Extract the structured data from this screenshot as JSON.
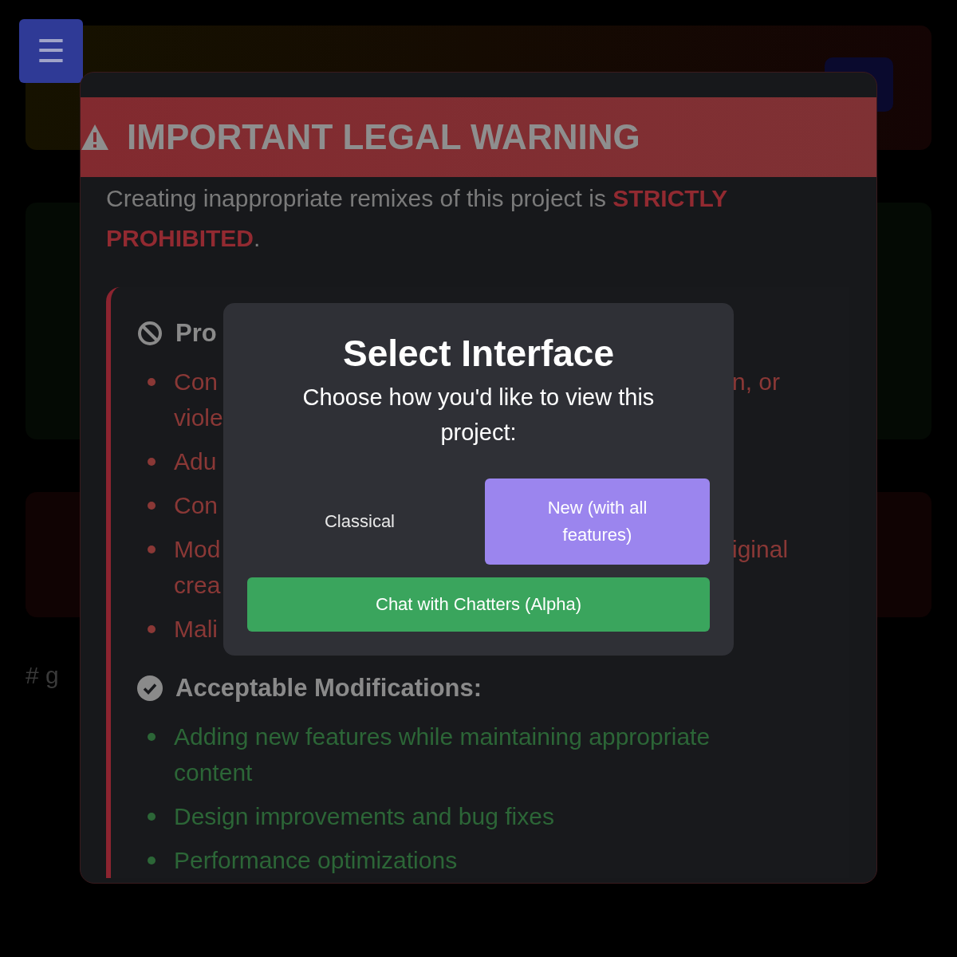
{
  "background": {
    "menu_button": "☰",
    "footer_text": "# g"
  },
  "legal_warning": {
    "title": "IMPORTANT LEGAL WARNING",
    "intro": "Creating inappropriate remixes of this project is **STRICTLY PROHIBITED**.",
    "sections": [
      {
        "kind": "prohibited",
        "heading": "Pro",
        "items": [
          {
            "lines": [
              {
                "start": "Con",
                "end": "n, or"
              },
              {
                "start": "viole"
              }
            ]
          },
          {
            "lines": [
              {
                "start": "Adu"
              }
            ]
          },
          {
            "lines": [
              {
                "start": "Con"
              }
            ]
          },
          {
            "lines": [
              {
                "start": "Mod",
                "end": "iginal"
              },
              {
                "start": "crea"
              }
            ]
          },
          {
            "lines": [
              {
                "start": "Mali"
              }
            ]
          }
        ]
      },
      {
        "kind": "acceptable",
        "heading": "Acceptable Modifications:",
        "items": [
          {
            "lines": [
              {
                "start": "Adding new features while maintaining appropriate"
              },
              {
                "start": "content"
              }
            ]
          },
          {
            "lines": [
              {
                "start": "Design improvements and bug fixes"
              }
            ]
          },
          {
            "lines": [
              {
                "start": "Performance optimizations"
              }
            ]
          }
        ]
      }
    ]
  },
  "dialog": {
    "title": "Select Interface",
    "subtitle": "Choose how you'd like to view this project:",
    "options": [
      {
        "label": "Classical",
        "selected": false
      },
      {
        "label": "New (with all features)",
        "selected": true
      }
    ],
    "chat_button": "Chat with Chatters (Alpha)"
  }
}
